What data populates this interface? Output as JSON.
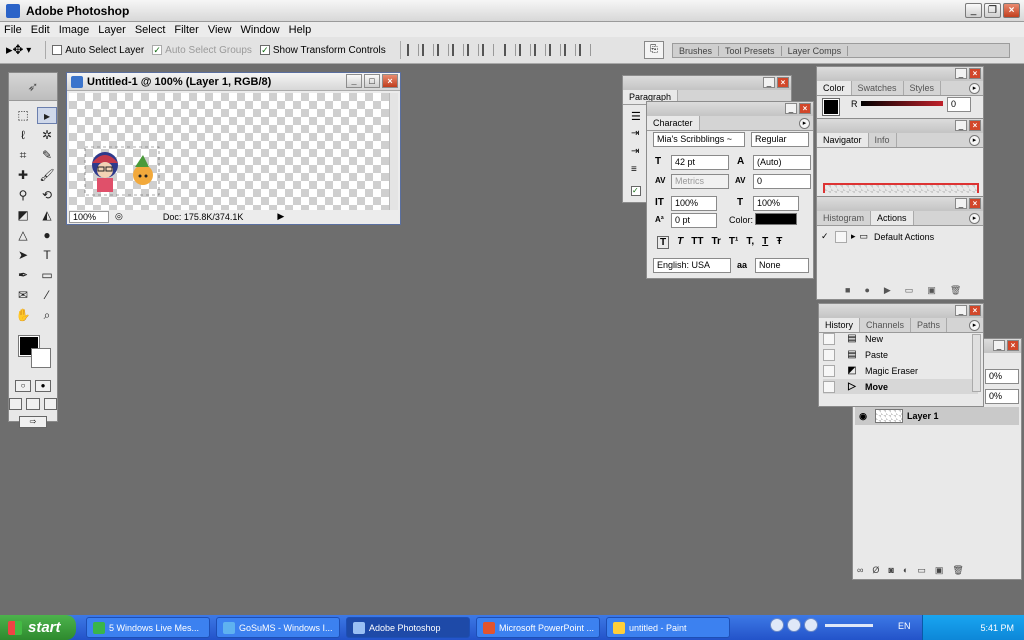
{
  "app": {
    "title": "Adobe Photoshop"
  },
  "menu": [
    "File",
    "Edit",
    "Image",
    "Layer",
    "Select",
    "Filter",
    "View",
    "Window",
    "Help"
  ],
  "options": {
    "auto_select_layer": "Auto Select Layer",
    "auto_select_groups": "Auto Select Groups",
    "show_transform_controls": "Show Transform Controls",
    "well_tabs": [
      "Brushes",
      "Tool Presets",
      "Layer Comps"
    ]
  },
  "document": {
    "title": "Untitled-1 @ 100% (Layer 1, RGB/8)",
    "zoom": "100%",
    "doc_size": "Doc: 175.8K/374.1K"
  },
  "paragraph_panel": {
    "tab": "Paragraph"
  },
  "character_panel": {
    "tab": "Character",
    "font_family": "Mia's Scribblings ~",
    "font_style": "Regular",
    "size": "42 pt",
    "leading": "(Auto)",
    "kerning": "Metrics",
    "tracking": "0",
    "vscale": "100%",
    "hscale": "100%",
    "baseline": "0 pt",
    "color_label": "Color:",
    "language": "English: USA",
    "antialias_icon": "aa",
    "antialias": "None",
    "style_buttons": [
      "T",
      "T",
      "TT",
      "Tr",
      "T¹",
      "T,",
      "T",
      "Ŧ"
    ]
  },
  "color_panel": {
    "tabs": [
      "Color",
      "Swatches",
      "Styles"
    ],
    "channel": "R",
    "value": "0",
    "accent": "#c0202a"
  },
  "navigator_panel": {
    "tabs": [
      "Navigator",
      "Info"
    ]
  },
  "actions_panel": {
    "tabs": [
      "Histogram",
      "Actions"
    ],
    "set": "Default Actions"
  },
  "history_panel": {
    "tabs": [
      "History",
      "Channels",
      "Paths"
    ],
    "items": [
      "New",
      "Paste",
      "Magic Eraser",
      "Move"
    ]
  },
  "layers_panel": {
    "opacity": "0%",
    "fill": "0%",
    "layer_name": "Layer 1"
  },
  "taskbar": {
    "start": "start",
    "tasks": [
      "5 Windows Live Mes...",
      "GoSuMS - Windows I...",
      "Adobe Photoshop",
      "Microsoft PowerPoint ...",
      "untitled - Paint"
    ],
    "lang": "EN",
    "clock": "5:41 PM"
  }
}
